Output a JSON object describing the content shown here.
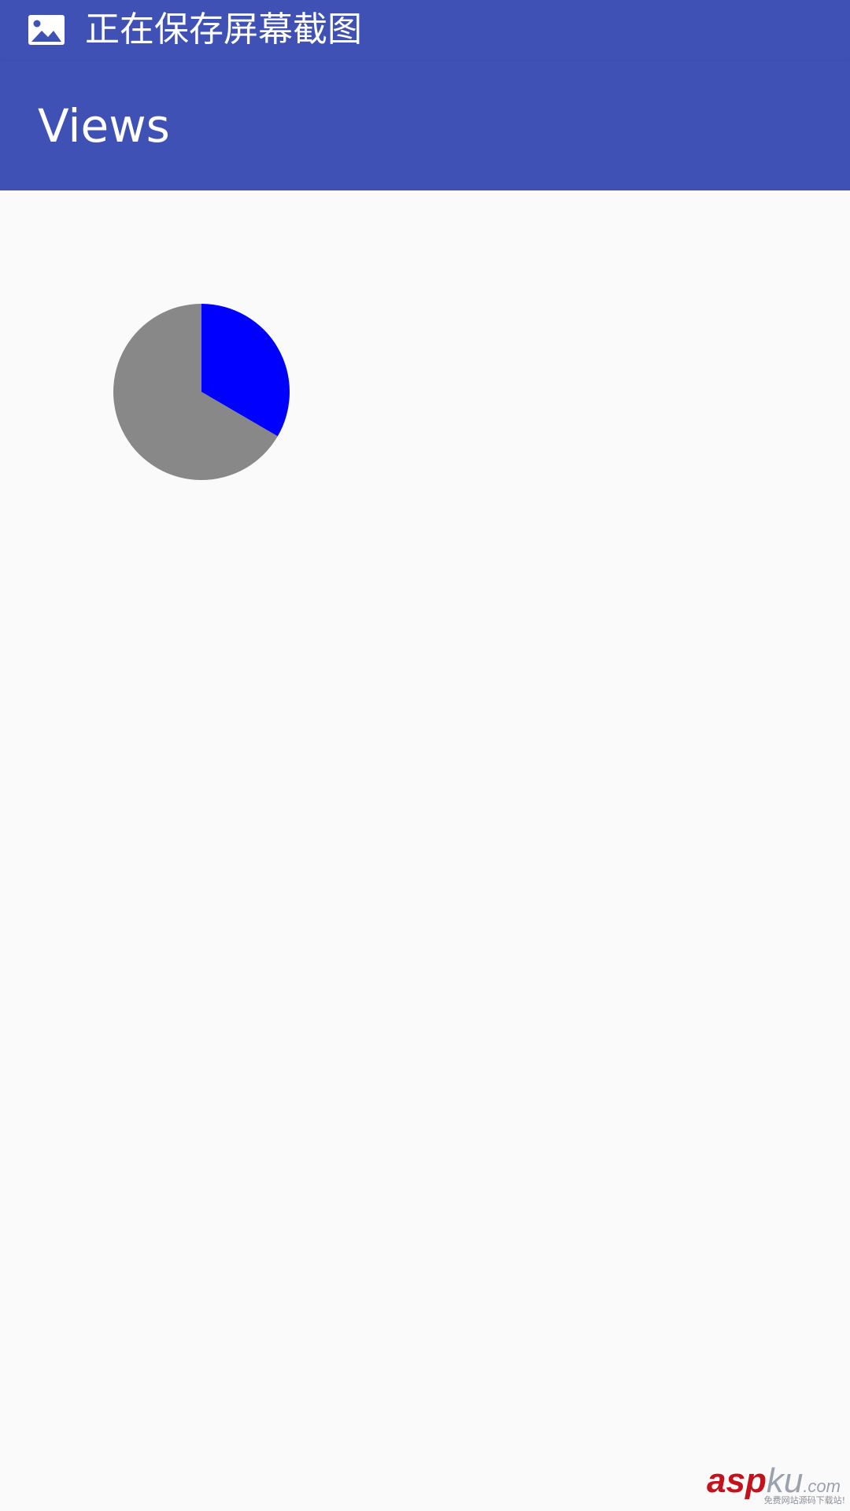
{
  "status_bar": {
    "icon": "image-icon",
    "text": "正在保存屏幕截图"
  },
  "app_bar": {
    "title": "Views"
  },
  "chart_data": {
    "type": "pie",
    "slices": [
      {
        "value": 33.4,
        "color": "#0000ff"
      },
      {
        "value": 66.6,
        "color": "#888888"
      }
    ]
  },
  "watermark": {
    "main": "asp",
    "ku": "ku",
    "dot": ".com",
    "sub": "免费网站源码下载站!"
  },
  "colors": {
    "primary": "#3f51b5",
    "background": "#fafafa"
  }
}
